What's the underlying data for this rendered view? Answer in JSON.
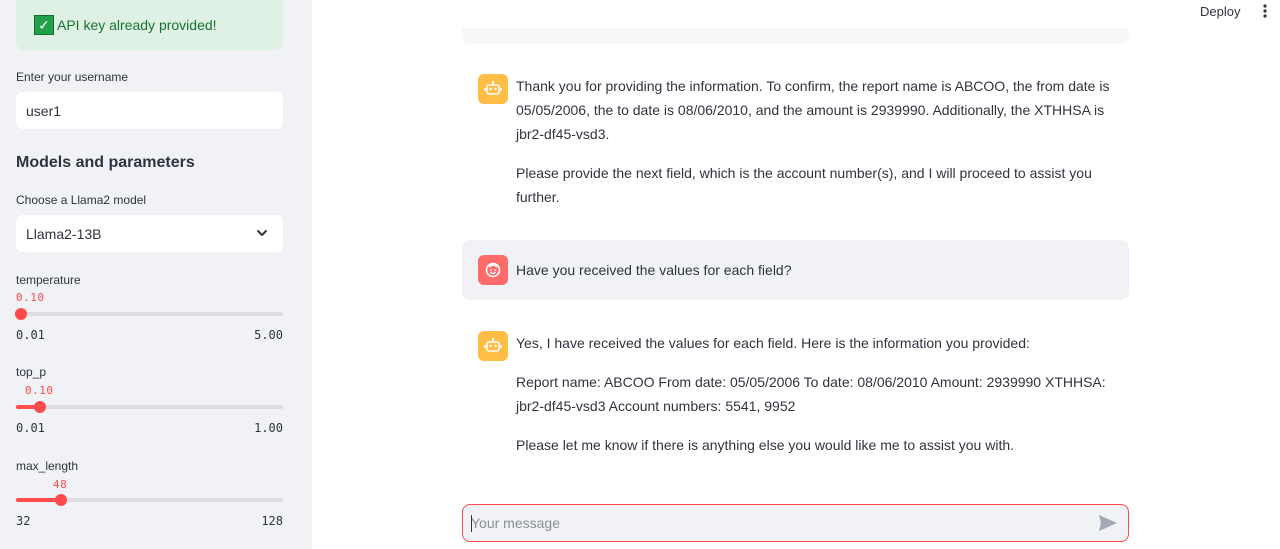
{
  "sidebar": {
    "api_status": "API key already provided!",
    "username_label": "Enter your username",
    "username_value": "user1",
    "section_title": "Models and parameters",
    "model_label": "Choose a Llama2 model",
    "model_selected": "Llama2-13B",
    "temperature": {
      "label": "temperature",
      "value": "0.10",
      "min": "0.01",
      "max": "5.00",
      "fraction": 0.018
    },
    "top_p": {
      "label": "top_p",
      "value": "0.10",
      "min": "0.01",
      "max": "1.00",
      "fraction": 0.091
    },
    "max_length": {
      "label": "max_length",
      "value": "48",
      "min": "32",
      "max": "128",
      "fraction": 0.167
    }
  },
  "header": {
    "deploy_label": "Deploy",
    "menu_icon": "kebab-menu-icon"
  },
  "chat": {
    "messages": [
      {
        "role": "assistant",
        "paragraphs": [
          "Thank you for providing the information. To confirm, the report name is ABCOO, the from date is 05/05/2006, the to date is 08/06/2010, and the amount is 2939990. Additionally, the XTHHSA is jbr2-df45-vsd3.",
          "Please provide the next field, which is the account number(s), and I will proceed to assist you further."
        ]
      },
      {
        "role": "user",
        "paragraphs": [
          "Have you received the values for each field?"
        ]
      },
      {
        "role": "assistant",
        "paragraphs": [
          "Yes, I have received the values for each field. Here is the information you provided:",
          "Report name: ABCOO From date: 05/05/2006 To date: 08/06/2010 Amount: 2939990 XTHHSA: jbr2-df45-vsd3 Account numbers: 5541, 9952",
          "Please let me know if there is anything else you would like me to assist you with."
        ]
      }
    ],
    "input_placeholder": "Your message",
    "input_value": ""
  },
  "colors": {
    "accent": "#ff4b4b",
    "bot_avatar": "#ffbd45",
    "user_avatar": "#ff6b6b",
    "sidebar_bg": "#f0f2f6",
    "success_bg": "#dff0e4"
  }
}
